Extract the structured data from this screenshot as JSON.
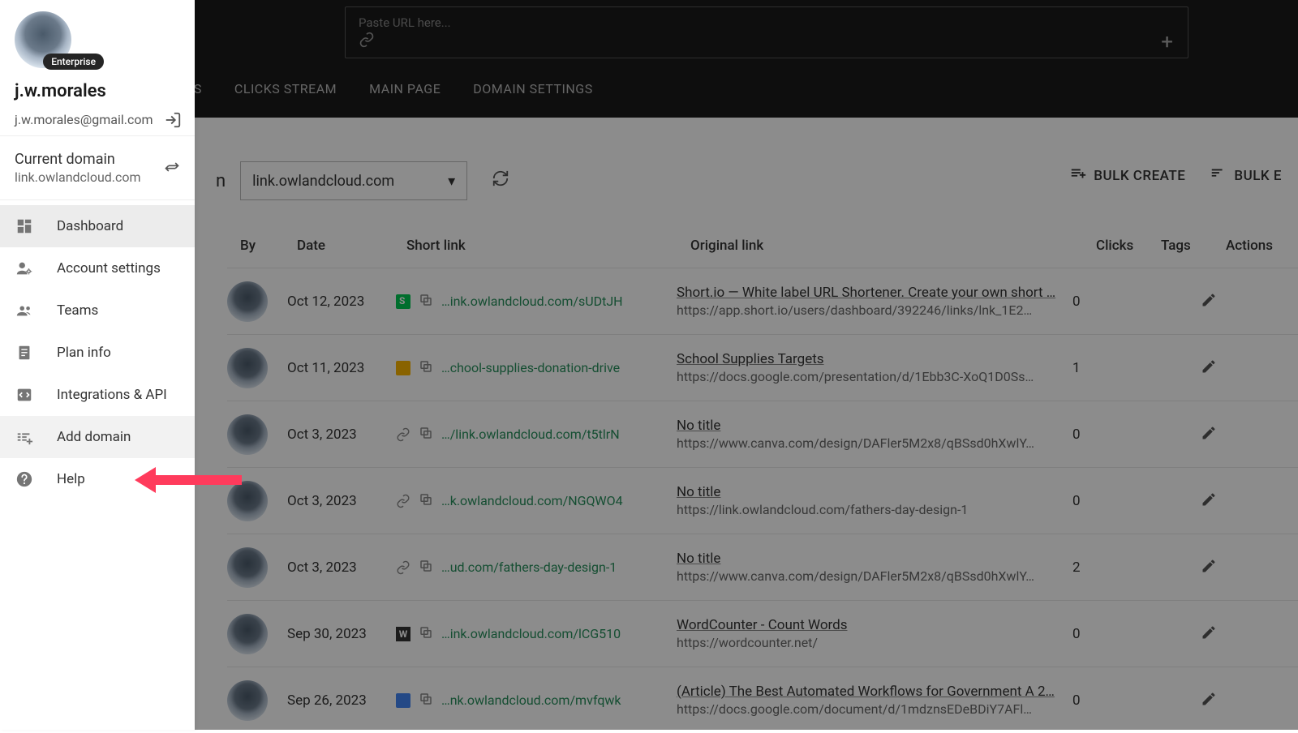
{
  "sidebar": {
    "badge": "Enterprise",
    "username": "j.w.morales",
    "email": "j.w.morales@gmail.com",
    "current_domain_label": "Current domain",
    "current_domain_value": "link.owlandcloud.com",
    "nav": [
      {
        "label": "Dashboard",
        "icon": "dashboard"
      },
      {
        "label": "Account settings",
        "icon": "person-gear"
      },
      {
        "label": "Teams",
        "icon": "group"
      },
      {
        "label": "Plan info",
        "icon": "receipt"
      },
      {
        "label": "Integrations & API",
        "icon": "code-box"
      },
      {
        "label": "Add domain",
        "icon": "domain-add"
      },
      {
        "label": "Help",
        "icon": "help"
      }
    ]
  },
  "header": {
    "url_placeholder": "Paste URL here...",
    "tabs": [
      "CS",
      "CLICKS STREAM",
      "MAIN PAGE",
      "DOMAIN SETTINGS"
    ]
  },
  "content": {
    "domain_letter": "n",
    "domain_selected": "link.owlandcloud.com",
    "bulk_create": "BULK CREATE",
    "bulk_edit": "BULK E",
    "columns": {
      "by": "By",
      "date": "Date",
      "short": "Short link",
      "orig": "Original link",
      "clicks": "Clicks",
      "tags": "Tags",
      "actions": "Actions"
    },
    "rows": [
      {
        "date": "Oct 12, 2023",
        "favicon": "shortio",
        "short": "…ink.owlandcloud.com/sUDtJH",
        "title": "Short.io — White label URL Shortener. Create your own short …",
        "url": "https://app.short.io/users/dashboard/392246/links/lnk_1E2…",
        "clicks": "0"
      },
      {
        "date": "Oct 11, 2023",
        "favicon": "slides",
        "short": "…chool-supplies-donation-drive",
        "title": "School Supplies Targets",
        "url": "https://docs.google.com/presentation/d/1Ebb3C-XoQ1D0Ss…",
        "clicks": "1"
      },
      {
        "date": "Oct 3, 2023",
        "favicon": "link",
        "short": "…/link.owlandcloud.com/t5tlrN",
        "title": "No title",
        "url": "https://www.canva.com/design/DAFler5M2x8/qBSsd0hXwlY…",
        "clicks": "0"
      },
      {
        "date": "Oct 3, 2023",
        "favicon": "link",
        "short": "…k.owlandcloud.com/NGQWO4",
        "title": "No title",
        "url": "https://link.owlandcloud.com/fathers-day-design-1",
        "clicks": "0"
      },
      {
        "date": "Oct 3, 2023",
        "favicon": "link",
        "short": "…ud.com/fathers-day-design-1",
        "title": "No title",
        "url": "https://www.canva.com/design/DAFler5M2x8/qBSsd0hXwlY…",
        "clicks": "2"
      },
      {
        "date": "Sep 30, 2023",
        "favicon": "w",
        "short": "…ink.owlandcloud.com/lCG510",
        "title": "WordCounter - Count Words",
        "url": "https://wordcounter.net/",
        "clicks": "0"
      },
      {
        "date": "Sep 26, 2023",
        "favicon": "docs",
        "short": "…nk.owlandcloud.com/mvfqwk",
        "title": "(Article) The Best Automated Workflows for Government A 2…",
        "url": "https://docs.google.com/document/d/1mdznsEDeBDiY7AFl…",
        "clicks": "0"
      }
    ]
  }
}
